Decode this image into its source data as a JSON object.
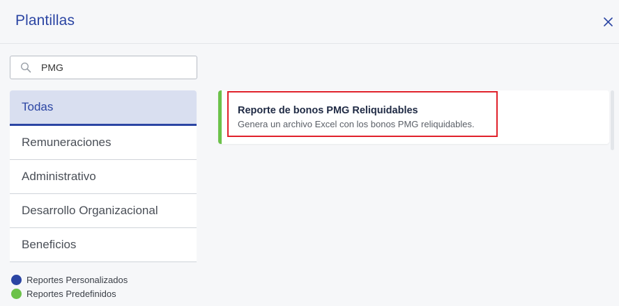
{
  "dialog": {
    "title": "Plantillas",
    "close_icon": "close-icon"
  },
  "search": {
    "value": "PMG",
    "placeholder": ""
  },
  "categories": [
    {
      "label": "Todas",
      "active": true
    },
    {
      "label": "Remuneraciones",
      "active": false
    },
    {
      "label": "Administrativo",
      "active": false
    },
    {
      "label": "Desarrollo Organizacional",
      "active": false
    },
    {
      "label": "Beneficios",
      "active": false
    }
  ],
  "legend": [
    {
      "label": "Reportes Personalizados",
      "color": "#2b45a3"
    },
    {
      "label": "Reportes Predefinidos",
      "color": "#6cc24a"
    }
  ],
  "results": [
    {
      "title": "Reporte de bonos PMG Reliquidables",
      "description": "Genera un archivo Excel con los bonos PMG reliquidables.",
      "type_color": "#6cc24a"
    }
  ],
  "colors": {
    "accent": "#2b45a3",
    "predefined": "#6cc24a",
    "highlight": "#e0202a"
  }
}
